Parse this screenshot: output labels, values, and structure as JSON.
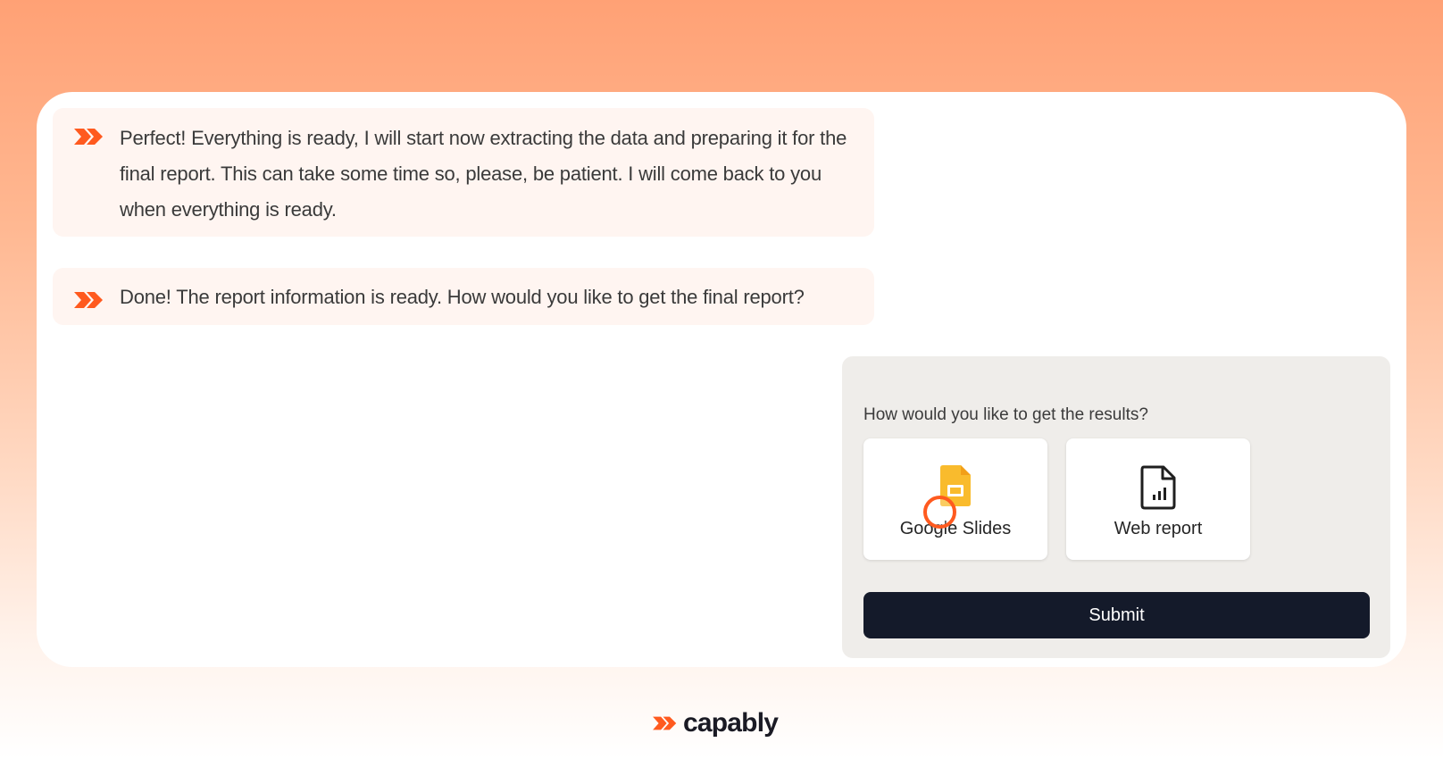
{
  "chat": {
    "messages": [
      {
        "icon": "capably-logo-icon",
        "text": "Perfect! Everything is ready, I will start now extracting the data and preparing it for the final report. This can take some time so, please, be patient. I will come back to you when everything is ready."
      },
      {
        "icon": "capably-logo-icon",
        "text": "Done! The report information is ready. How would you like to get the final report?"
      }
    ]
  },
  "form": {
    "question": "How would you like to get the results?",
    "options": [
      {
        "label": "Google Slides",
        "icon": "google-slides-icon"
      },
      {
        "label": "Web report",
        "icon": "report-document-icon"
      }
    ],
    "submit_label": "Submit"
  },
  "brand": {
    "name": "capably",
    "icon": "capably-logo-icon"
  },
  "colors": {
    "accent": "#ff5a1f",
    "message_bg": "#fff5f1",
    "panel_bg": "#efedea",
    "submit_bg": "#141a2a",
    "slides_yellow": "#f9bb2d"
  }
}
